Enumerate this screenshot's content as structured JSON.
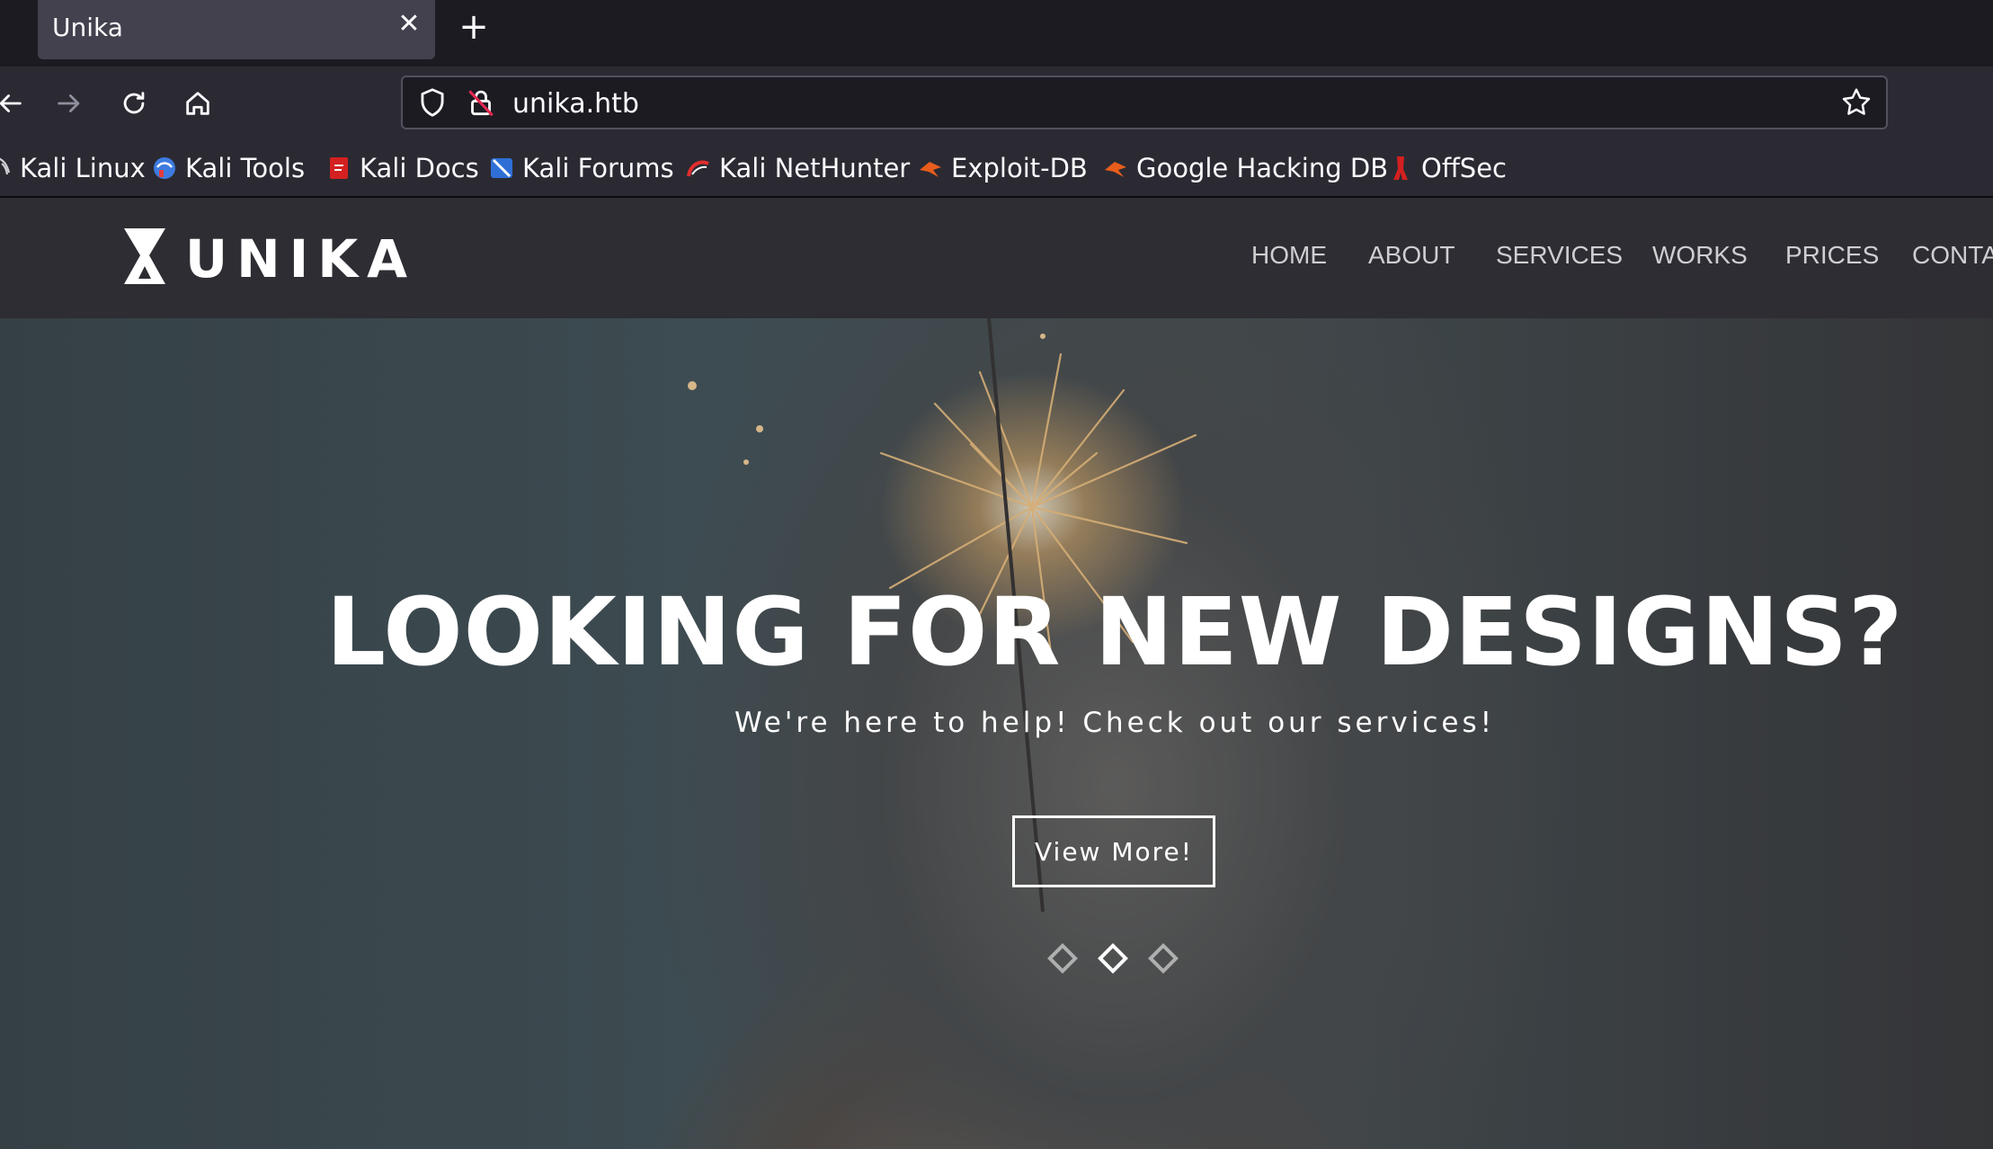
{
  "browser": {
    "tab_title": "Unika",
    "url": "unika.htb",
    "bookmarks": [
      {
        "label": "Kali Linux",
        "icon": "kali-dragon-icon"
      },
      {
        "label": "Kali Tools",
        "icon": "kali-tools-icon"
      },
      {
        "label": "Kali Docs",
        "icon": "kali-docs-icon"
      },
      {
        "label": "Kali Forums",
        "icon": "kali-forums-icon"
      },
      {
        "label": "Kali NetHunter",
        "icon": "kali-nethunter-icon"
      },
      {
        "label": "Exploit-DB",
        "icon": "exploit-db-icon"
      },
      {
        "label": "Google Hacking DB",
        "icon": "ghdb-icon"
      },
      {
        "label": "OffSec",
        "icon": "offsec-icon"
      }
    ]
  },
  "site": {
    "logo_text": "UNIKA",
    "nav": [
      "HOME",
      "ABOUT",
      "SERVICES",
      "WORKS",
      "PRICES",
      "CONTA"
    ]
  },
  "hero": {
    "title": "LOOKING FOR NEW DESIGNS?",
    "subtitle": "We're here to help! Check out our services!",
    "button": "View More!",
    "slides": 3,
    "active_slide": 2
  },
  "colors": {
    "chrome_dark": "#1c1b22",
    "chrome": "#2b2a33",
    "site_header": "#2d2d33",
    "text_light": "#fbfbfe"
  }
}
